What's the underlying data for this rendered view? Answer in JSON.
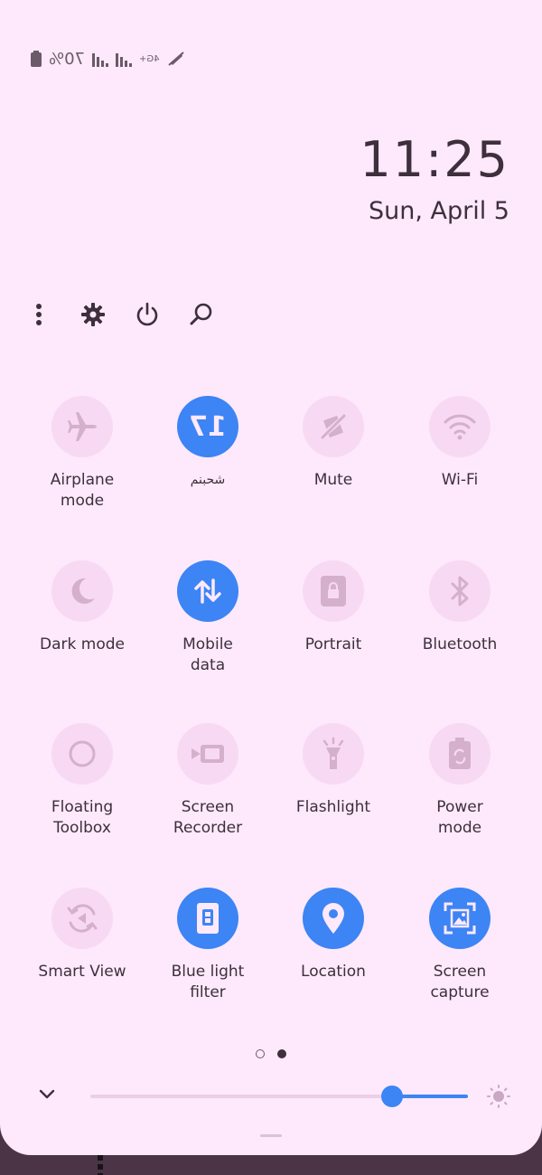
{
  "status": {
    "battery": "70%",
    "network": "4G+"
  },
  "clock": {
    "time": "11:25",
    "date": "Sun, April 5"
  },
  "tiles": [
    {
      "label": "Wi-Fi",
      "icon": "wifi-icon",
      "on": false
    },
    {
      "label": "Mute",
      "icon": "mute-icon",
      "on": false
    },
    {
      "label": "ﺷﺤﺒﻨﻢ",
      "icon": "number-17-icon",
      "badge": "17",
      "on": true
    },
    {
      "label": "Airplane\nmode",
      "icon": "airplane-icon",
      "on": false
    },
    {
      "label": "Bluetooth",
      "icon": "bluetooth-icon",
      "on": false
    },
    {
      "label": "Portrait",
      "icon": "portrait-lock-icon",
      "on": false
    },
    {
      "label": "Mobile\ndata",
      "icon": "mobile-data-icon",
      "on": true
    },
    {
      "label": "Dark mode",
      "icon": "moon-icon",
      "on": false
    },
    {
      "label": "Power\nmode",
      "icon": "battery-saver-icon",
      "on": false
    },
    {
      "label": "Flashlight",
      "icon": "flashlight-icon",
      "on": false
    },
    {
      "label": "Screen\nRecorder",
      "icon": "video-camera-icon",
      "on": false
    },
    {
      "label": "Floating\nToolbox",
      "icon": "circle-icon",
      "on": false
    },
    {
      "label": "Screen\ncapture",
      "icon": "screen-capture-icon",
      "on": true
    },
    {
      "label": "Location",
      "icon": "location-pin-icon",
      "on": true
    },
    {
      "label": "Blue light\nfilter",
      "icon": "blue-light-filter-icon",
      "on": true
    },
    {
      "label": "Smart View",
      "icon": "smart-view-icon",
      "on": false
    }
  ],
  "pager": {
    "pages": 2,
    "current": 2
  },
  "brightness": {
    "level": 0.2
  },
  "colors": {
    "accent": "#3d84f5",
    "panel": "#fde9fb",
    "tile_off": "#f8d9f3",
    "text": "#3e2f3c"
  }
}
